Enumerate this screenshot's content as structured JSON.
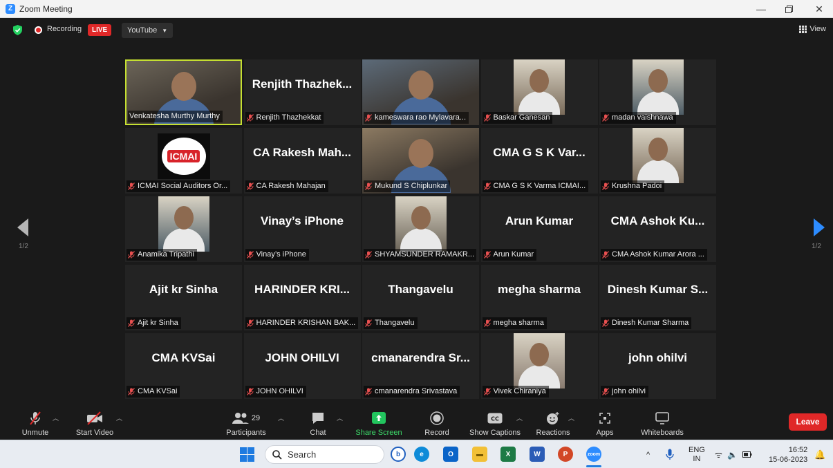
{
  "window": {
    "title": "Zoom Meeting"
  },
  "topbar": {
    "recording_label": "Recording",
    "live_label": "LIVE",
    "stream_label": "YouTube",
    "view_label": "View"
  },
  "pagination": {
    "left": "1/2",
    "right": "1/2"
  },
  "participants": [
    {
      "big": "",
      "name": "Venkatesha Murthy Murthy",
      "video": true,
      "active": true,
      "muted": false
    },
    {
      "big": "Renjith  Thazhek...",
      "name": "Renjith Thazhekkat",
      "video": false,
      "muted": true
    },
    {
      "big": "",
      "name": "kameswara rao Mylavara...",
      "video": true,
      "muted": true
    },
    {
      "big": "",
      "name": "Baskar Ganesan",
      "video": true,
      "muted": true
    },
    {
      "big": "",
      "name": "madan vaishnawa",
      "video": true,
      "muted": true
    },
    {
      "big": "",
      "name": "ICMAI Social Auditors Or...",
      "video": true,
      "muted": true,
      "logo": "ICMAI"
    },
    {
      "big": "CA Rakesh  Mah...",
      "name": "CA Rakesh Mahajan",
      "video": false,
      "muted": true
    },
    {
      "big": "",
      "name": "Mukund S Chiplunkar",
      "video": true,
      "muted": true
    },
    {
      "big": "CMA  G S K Var...",
      "name": "CMA  G S K Varma ICMAI...",
      "video": false,
      "muted": true
    },
    {
      "big": "",
      "name": "Krushna Padoi",
      "video": true,
      "muted": true
    },
    {
      "big": "",
      "name": "Anamika Tripathi",
      "video": true,
      "muted": true
    },
    {
      "big": "Vinay’s iPhone",
      "name": "Vinay’s iPhone",
      "video": false,
      "muted": true
    },
    {
      "big": "",
      "name": "SHYAMSUNDER RAMAKR...",
      "video": true,
      "muted": true
    },
    {
      "big": "Arun Kumar",
      "name": "Arun Kumar",
      "video": false,
      "muted": true
    },
    {
      "big": "CMA  Ashok  Ku...",
      "name": "CMA Ashok Kumar Arora ...",
      "video": false,
      "muted": true
    },
    {
      "big": "Ajit kr Sinha",
      "name": "Ajit kr Sinha",
      "video": false,
      "muted": true
    },
    {
      "big": "HARINDER  KRI...",
      "name": "HARINDER KRISHAN BAK...",
      "video": false,
      "muted": true
    },
    {
      "big": "Thangavelu",
      "name": "Thangavelu",
      "video": false,
      "muted": true
    },
    {
      "big": "megha sharma",
      "name": "megha sharma",
      "video": false,
      "muted": true
    },
    {
      "big": "Dinesh  Kumar  S...",
      "name": "Dinesh Kumar Sharma",
      "video": false,
      "muted": true
    },
    {
      "big": "CMA KVSai",
      "name": "CMA KVSai",
      "video": false,
      "muted": true
    },
    {
      "big": "JOHN OHILVI",
      "name": "JOHN OHILVI",
      "video": false,
      "muted": true
    },
    {
      "big": "cmanarendra  Sr...",
      "name": "cmanarendra Srivastava",
      "video": false,
      "muted": true
    },
    {
      "big": "",
      "name": "Vivek Chiraniya",
      "video": true,
      "muted": true
    },
    {
      "big": "john ohilvi",
      "name": "john ohilvi",
      "video": false,
      "muted": true
    }
  ],
  "toolbar": {
    "unmute": "Unmute",
    "start_video": "Start Video",
    "participants": "Participants",
    "participant_count": "29",
    "chat": "Chat",
    "share_screen": "Share Screen",
    "record": "Record",
    "show_captions": "Show Captions",
    "reactions": "Reactions",
    "apps": "Apps",
    "whiteboards": "Whiteboards",
    "leave": "Leave"
  },
  "taskbar": {
    "search_label": "Search",
    "lang_1": "ENG",
    "lang_2": "IN",
    "time": "16:52",
    "date": "15-06-2023"
  },
  "colors": {
    "accent": "#2d8cff",
    "active_speaker": "#c6e031",
    "leave": "#e02828",
    "share": "#22c55e"
  }
}
